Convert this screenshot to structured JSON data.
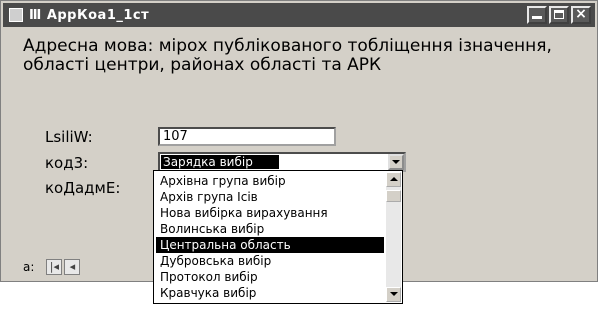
{
  "window": {
    "title": "Ⅲ АррКоа1_1ст",
    "colors": {
      "titlebar": "#4a4a4a",
      "face": "#d4d0c8",
      "selection": "#000000"
    }
  },
  "header_text": "Адресна мова: мірох публікованого тобліщення ізначення, області центри, районах області та АРК",
  "fields": {
    "id_label": "LsiliW:",
    "id_value": "107",
    "type_label": "код3:",
    "type_value": "Зарядка вибір",
    "parent_label": "коДадмЕ:"
  },
  "dropdown": {
    "items": [
      "Архівна група вибір",
      "Архів група Ісів",
      "Нова вибірка вирахування",
      "Волинська вибір",
      "Центральна область",
      "Дубровська вибір",
      "Протокол вибір",
      "Кравчука вибір"
    ],
    "selected_index": 4,
    "icons": {
      "scroll_up": "chevron-up-icon",
      "scroll_down": "chevron-down-icon"
    }
  },
  "nav": {
    "label": "а:",
    "first": "|◂",
    "prev": "◂"
  }
}
